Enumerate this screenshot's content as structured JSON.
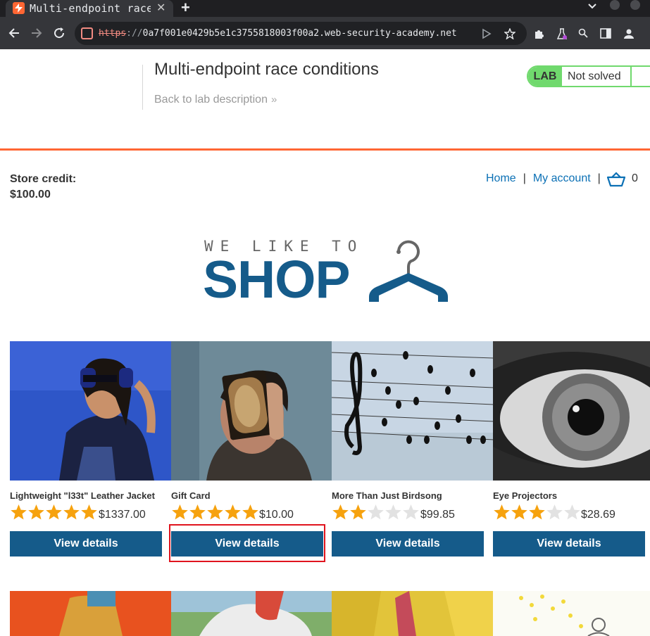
{
  "browser": {
    "tab_title": "Multi-endpoint race conditions",
    "tab_close": "✕",
    "new_tab": "+",
    "url_scheme": "https",
    "url_separator": "://",
    "url_host": "0a7f001e0429b5e1c3755818003f00a2.web-security-academy.net"
  },
  "lab": {
    "title": "Multi-endpoint race conditions",
    "back_link": "Back to lab description",
    "back_chevron": "»",
    "badge": "LAB",
    "status": "Not solved",
    "colors": {
      "accent": "#ff6633",
      "status_green": "#70d96d"
    }
  },
  "store": {
    "credit_label": "Store credit:",
    "credit_value": "$100.00",
    "nav": {
      "home": "Home",
      "sep1": "|",
      "account": "My account",
      "sep2": "|"
    },
    "cart_count": "0"
  },
  "logo": {
    "tagline": "WE LIKE TO",
    "word": "SHOP"
  },
  "products": [
    {
      "name": "Lightweight \"l33t\" Leather Jacket",
      "rating": 5,
      "price": "$1337.00",
      "button": "View details"
    },
    {
      "name": "Gift Card",
      "rating": 5,
      "price": "$10.00",
      "button": "View details"
    },
    {
      "name": "More Than Just Birdsong",
      "rating": 2,
      "price": "$99.85",
      "button": "View details"
    },
    {
      "name": "Eye Projectors",
      "rating": 3,
      "price": "$28.69",
      "button": "View details"
    }
  ],
  "colors": {
    "primary": "#155b8a",
    "link": "#0b70b5",
    "star_on": "#f6a20e",
    "star_off": "#e2e2e2",
    "highlight": "#e0141e"
  }
}
